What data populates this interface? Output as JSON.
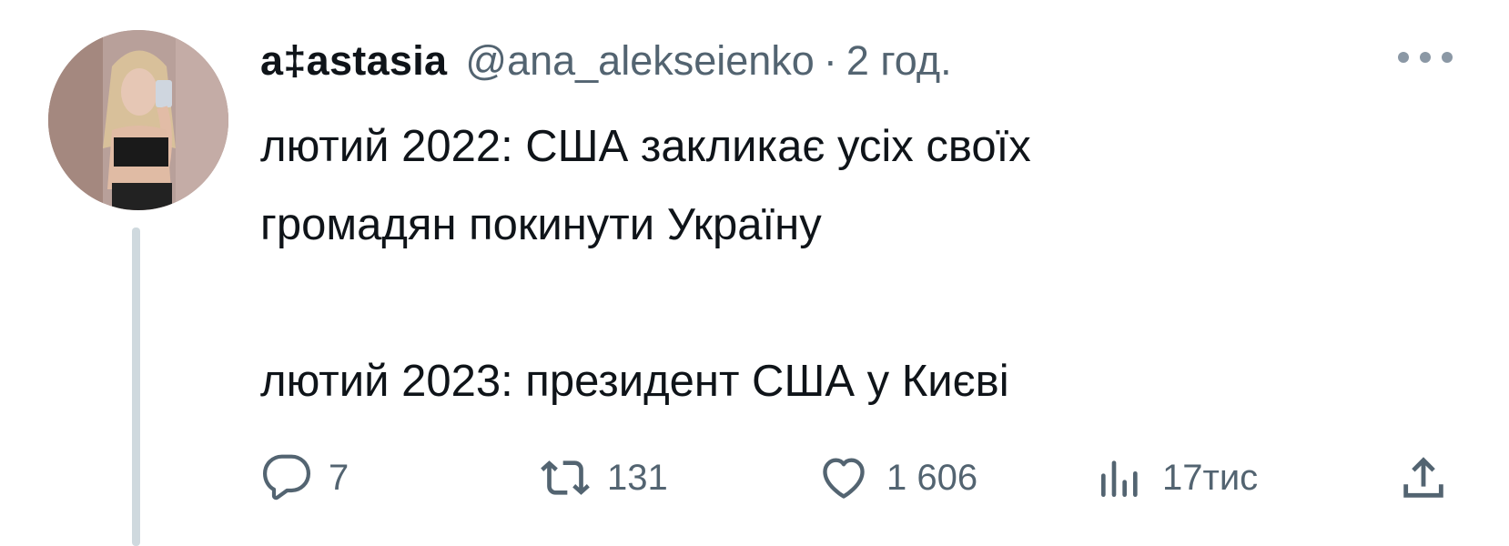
{
  "tweet": {
    "author_name": "a‡astasia",
    "handle": "@ana_alekseienko",
    "separator": "·",
    "time": "2 год.",
    "lines": [
      "лютий 2022: США закликає усіх своїх",
      "громадян покинути Україну",
      "",
      "лютий 2023: президент США у Києві"
    ]
  },
  "actions": {
    "reply_count": "7",
    "retweet_count": "131",
    "like_count": "1 606",
    "views_count": "17тис"
  },
  "icons": {
    "reply": "reply-icon",
    "retweet": "retweet-icon",
    "like": "heart-icon",
    "views": "views-icon",
    "share": "share-icon",
    "more": "more-icon"
  },
  "colors": {
    "text": "#0f1419",
    "secondary": "#536471",
    "thread_line": "#cfd9de"
  }
}
